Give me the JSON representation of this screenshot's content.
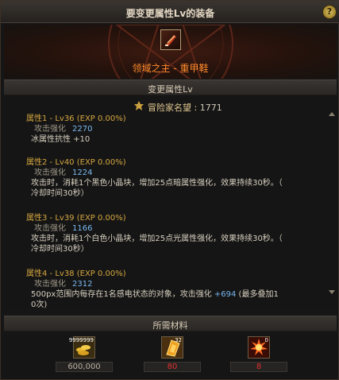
{
  "window": {
    "title": "要变更属性Lv的装备",
    "help_label": "?"
  },
  "item": {
    "name": "领域之主 - 重甲鞋",
    "icon": "boots-icon"
  },
  "change_section": {
    "title": "变更属性Lv"
  },
  "fame": {
    "label": "冒险家名望",
    "value": "1771"
  },
  "attributes": [
    {
      "header": "属性1 - Lv36 (EXP 0.00%)",
      "stat_label": "攻击强化",
      "stat_value": "2270",
      "desc": [
        "冰属性抗性 +10"
      ]
    },
    {
      "header": "属性2 - Lv40 (EXP 0.00%)",
      "stat_label": "攻击强化",
      "stat_value": "1224",
      "desc": [
        "攻击时，消耗1个黑色小晶块，增加25点暗属性强化，效果持续30秒。（",
        "冷却时间30秒）"
      ]
    },
    {
      "header": "属性3 - Lv39 (EXP 0.00%)",
      "stat_label": "攻击强化",
      "stat_value": "1166",
      "desc": [
        "攻击时，消耗1个白色小晶块，增加25点光属性强化，效果持续30秒。（",
        "冷却时间30秒）"
      ]
    },
    {
      "header": "属性4 - Lv38 (EXP 0.00%)",
      "stat_label": "攻击强化",
      "stat_value": "2312",
      "desc_pre": "500px范围内每存在1名感电状态的对象，攻击强化 ",
      "desc_num": "+694",
      "desc_post": " (最多叠加1",
      "desc_tail": "0次)"
    }
  ],
  "materials_section": {
    "title": "所需材料"
  },
  "materials": [
    {
      "icon": "gold-coins-icon",
      "badge": "9999999",
      "quantity": "600,000",
      "qty_color": "#b8b0a0"
    },
    {
      "icon": "crystal-card-icon",
      "badge": "32",
      "quantity": "80",
      "qty_color": "#e03030"
    },
    {
      "icon": "explosion-orb-icon",
      "badge": "0",
      "quantity": "8",
      "qty_color": "#e03030"
    }
  ]
}
